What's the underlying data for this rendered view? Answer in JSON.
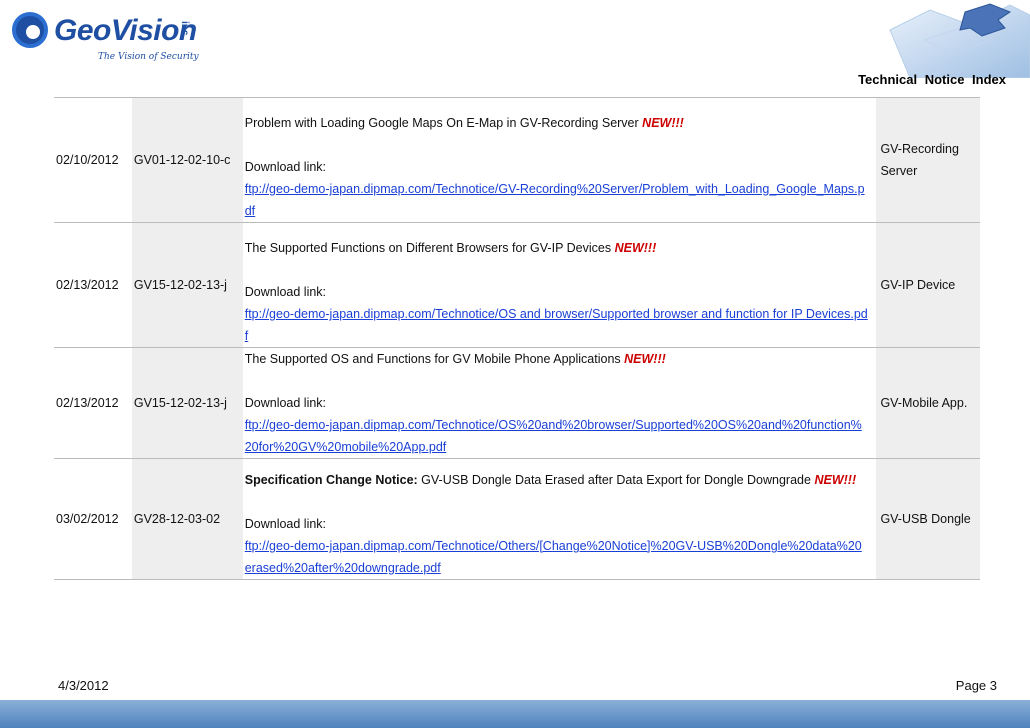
{
  "header": {
    "logo_word": "GeoVision",
    "logo_inc": "inc",
    "logo_tagline": "The Vision of Security",
    "doc_title": "Technical Notice Index"
  },
  "notices": [
    {
      "date": "02/10/2012",
      "id": "GV01-12-02-10-c",
      "title_prefix": "",
      "title": "Problem with Loading Google Maps On E-Map in GV-Recording Server",
      "new_label": "NEW!!!",
      "download_label": "Download link:",
      "link": "ftp://geo-demo-japan.dipmap.com/Technotice/GV-Recording%20Server/Problem_with_Loading_Google_Maps.pdf",
      "product": "GV-Recording Server"
    },
    {
      "date": "02/13/2012",
      "id": "GV15-12-02-13-j",
      "title_prefix": "",
      "title": "The Supported Functions on Different Browsers for GV-IP Devices",
      "new_label": "NEW!!!",
      "download_label": "Download link:",
      "link": "ftp://geo-demo-japan.dipmap.com/Technotice/OS and browser/Supported browser and function for IP Devices.pdf",
      "product": "GV-IP Device"
    },
    {
      "date": "02/13/2012",
      "id": "GV15-12-02-13-j",
      "title_prefix": "",
      "title": "The Supported OS and Functions for GV Mobile Phone Applications",
      "new_label": "NEW!!!",
      "download_label": "Download link:",
      "link": "ftp://geo-demo-japan.dipmap.com/Technotice/OS%20and%20browser/Supported%20OS%20and%20function%20for%20GV%20mobile%20App.pdf",
      "product": "GV-Mobile App."
    },
    {
      "date": "03/02/2012",
      "id": "GV28-12-03-02",
      "title_prefix": "Specification Change Notice:",
      "title": "GV-USB Dongle Data Erased after Data Export for Dongle Downgrade",
      "new_label": "NEW!!!",
      "download_label": "Download link:",
      "link": "ftp://geo-demo-japan.dipmap.com/Technotice/Others/[Change%20Notice]%20GV-USB%20Dongle%20data%20erased%20after%20downgrade.pdf",
      "product": "GV-USB Dongle"
    }
  ],
  "footer": {
    "date": "4/3/2012",
    "page": "Page 3"
  },
  "colors": {
    "brand_blue": "#1f4fa3",
    "new_red": "#cc0000",
    "link_blue": "#1a3fd6",
    "shade_gray": "#eeeeee"
  }
}
